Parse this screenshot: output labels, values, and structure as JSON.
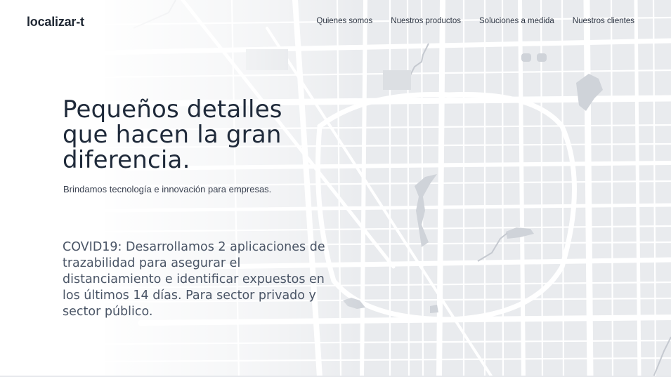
{
  "brand": {
    "logo_text": "localizar-t"
  },
  "nav": {
    "items": [
      {
        "label": "Quienes somos"
      },
      {
        "label": "Nuestros productos"
      },
      {
        "label": "Soluciones a medida"
      },
      {
        "label": "Nuestros clientes"
      }
    ]
  },
  "hero": {
    "title_line1": "Pequeños detalles",
    "title_line2": "que hacen la gran",
    "title_line3": "diferencia.",
    "subtitle": "Brindamos tecnología e innovación para empresas."
  },
  "covid": {
    "text": "COVID19: Desarrollamos 2 aplicaciones de trazabilidad para asegurar el distanciamiento e identificar expuestos en los últimos 14 días. Para sector privado y sector público."
  },
  "colors": {
    "text_dark": "#1f2a3a",
    "text_muted": "#4a5566",
    "map_block": "#e9ebee",
    "map_street": "#ffffff",
    "map_water": "#cfd3d9"
  },
  "icons": {
    "background": "city-map-background"
  }
}
